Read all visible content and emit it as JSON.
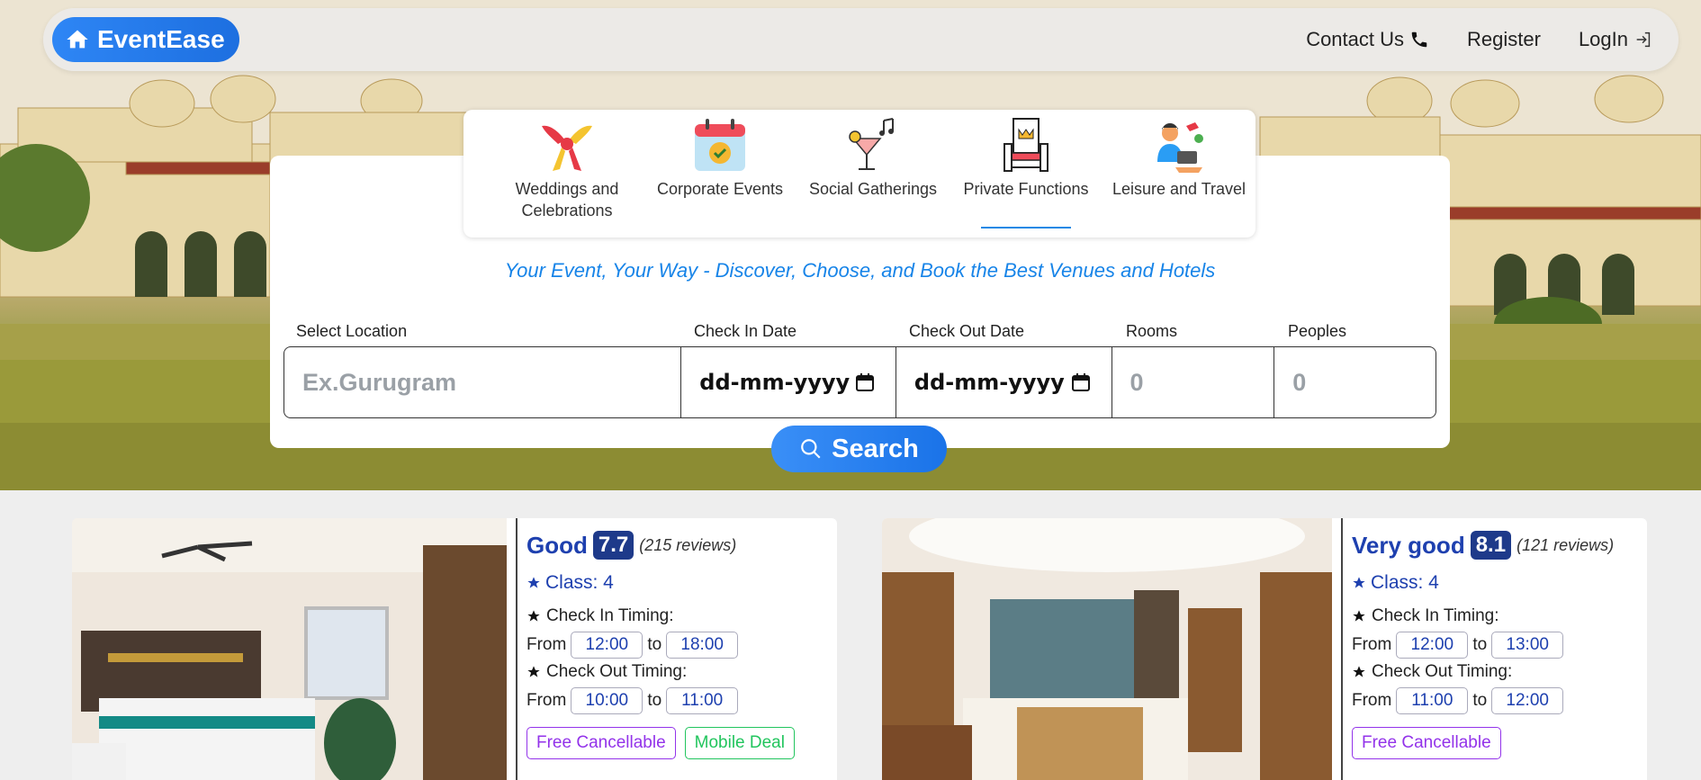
{
  "navbar": {
    "brand": "EventEase",
    "links": {
      "contact": "Contact Us",
      "register": "Register",
      "login": "LogIn"
    }
  },
  "categories": [
    {
      "label": "Weddings and Celebrations",
      "icon": "wedding-knot-icon"
    },
    {
      "label": "Corporate Events",
      "icon": "calendar-check-icon"
    },
    {
      "label": "Social Gatherings",
      "icon": "cocktail-icon"
    },
    {
      "label": "Private Functions",
      "icon": "throne-icon",
      "active": true
    },
    {
      "label": "Leisure and Travel",
      "icon": "traveler-icon"
    }
  ],
  "tagline": "Your Event, Your Way - Discover, Choose, and Book the Best Venues and Hotels",
  "search": {
    "location_label": "Select Location",
    "location_placeholder": "Ex.Gurugram",
    "checkin_label": "Check In Date",
    "checkin_value": "dd-mm-yyyy",
    "checkout_label": "Check Out Date",
    "checkout_value": "dd-mm-yyyy",
    "rooms_label": "Rooms",
    "rooms_placeholder": "0",
    "peoples_label": "Peoples",
    "peoples_placeholder": "0",
    "button": "Search"
  },
  "hotels": [
    {
      "rating_word": "Good",
      "rating_score": "7.7",
      "reviews": "(215 reviews)",
      "class": "Class: 4",
      "checkin_label": "Check In Timing:",
      "checkin_from": "12:00",
      "checkin_to": "18:00",
      "checkout_label": "Check Out Timing:",
      "checkout_from": "10:00",
      "checkout_to": "11:00",
      "from_text": "From",
      "to_text": "to",
      "badges": [
        "Free Cancellable",
        "Mobile Deal"
      ]
    },
    {
      "rating_word": "Very good",
      "rating_score": "8.1",
      "reviews": "(121 reviews)",
      "class": "Class: 4",
      "checkin_label": "Check In Timing:",
      "checkin_from": "12:00",
      "checkin_to": "13:00",
      "checkout_label": "Check Out Timing:",
      "checkout_from": "11:00",
      "checkout_to": "12:00",
      "from_text": "From",
      "to_text": "to",
      "badges": [
        "Free Cancellable"
      ]
    }
  ],
  "colors": {
    "brand": "#1d6fe0",
    "tagline": "#1784e8",
    "rating": "#1e3a8a",
    "badge_purple": "#9333ea",
    "badge_green": "#22c55e"
  }
}
